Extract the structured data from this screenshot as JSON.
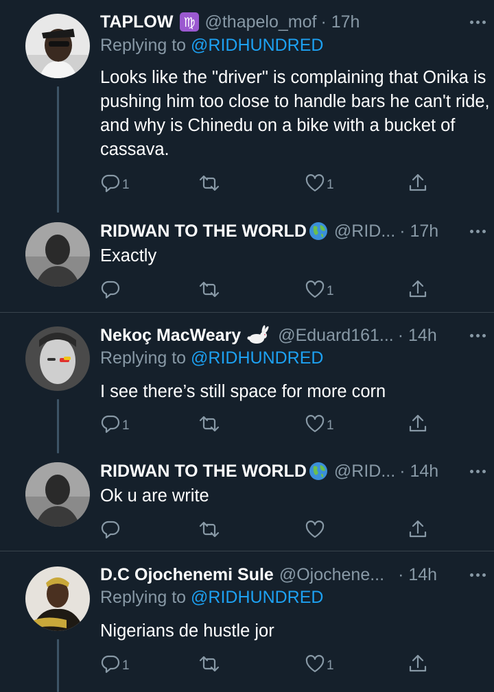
{
  "tweets": [
    {
      "name": "TAPLOW",
      "badge": "♍",
      "handle": "@thapelo_mof",
      "time": "· 17h",
      "reply_label": "Replying to ",
      "reply_to": "@RIDHUNDRED",
      "text": "Looks like the \"driver\" is complaining that Onika is pushing him too close to handle bars he can't ride, and why is Chinedu on a bike with a bucket of cassava.",
      "reply_count": "1",
      "retweet_count": "",
      "like_count": "1"
    },
    {
      "name": "RIDWAN TO THE WORLD",
      "badge": "🌍",
      "handle": "@RID...",
      "time": "· 17h",
      "text": "Exactly",
      "reply_count": "",
      "retweet_count": "",
      "like_count": "1"
    },
    {
      "name": "Nekoç MacWeary",
      "badge": "🐇",
      "handle": "@Eduard161...",
      "time": "· 14h",
      "reply_label": "Replying to ",
      "reply_to": "@RIDHUNDRED",
      "text": "I see there’s still space for more corn",
      "reply_count": "1",
      "retweet_count": "",
      "like_count": "1"
    },
    {
      "name": "RIDWAN TO THE WORLD",
      "badge": "🌍",
      "handle": "@RID...",
      "time": "· 14h",
      "text": "Ok u are write",
      "reply_count": "",
      "retweet_count": "",
      "like_count": ""
    },
    {
      "name": "D.C Ojochenemi Sule",
      "handle": "@Ojochene...",
      "time": "· 14h",
      "reply_label": "Replying to ",
      "reply_to": "@RIDHUNDRED",
      "text": "Nigerians de hustle jor",
      "reply_count": "1",
      "retweet_count": "",
      "like_count": "1"
    }
  ],
  "icons": {
    "reply": "reply-icon",
    "retweet": "retweet-icon",
    "like": "heart-icon",
    "share": "share-icon",
    "more": "more-icon"
  },
  "colors": {
    "background": "#15202b",
    "muted": "#8899a6",
    "link": "#1da1f2",
    "divider": "#38444d",
    "zodiac_badge": "#9b59d0"
  }
}
